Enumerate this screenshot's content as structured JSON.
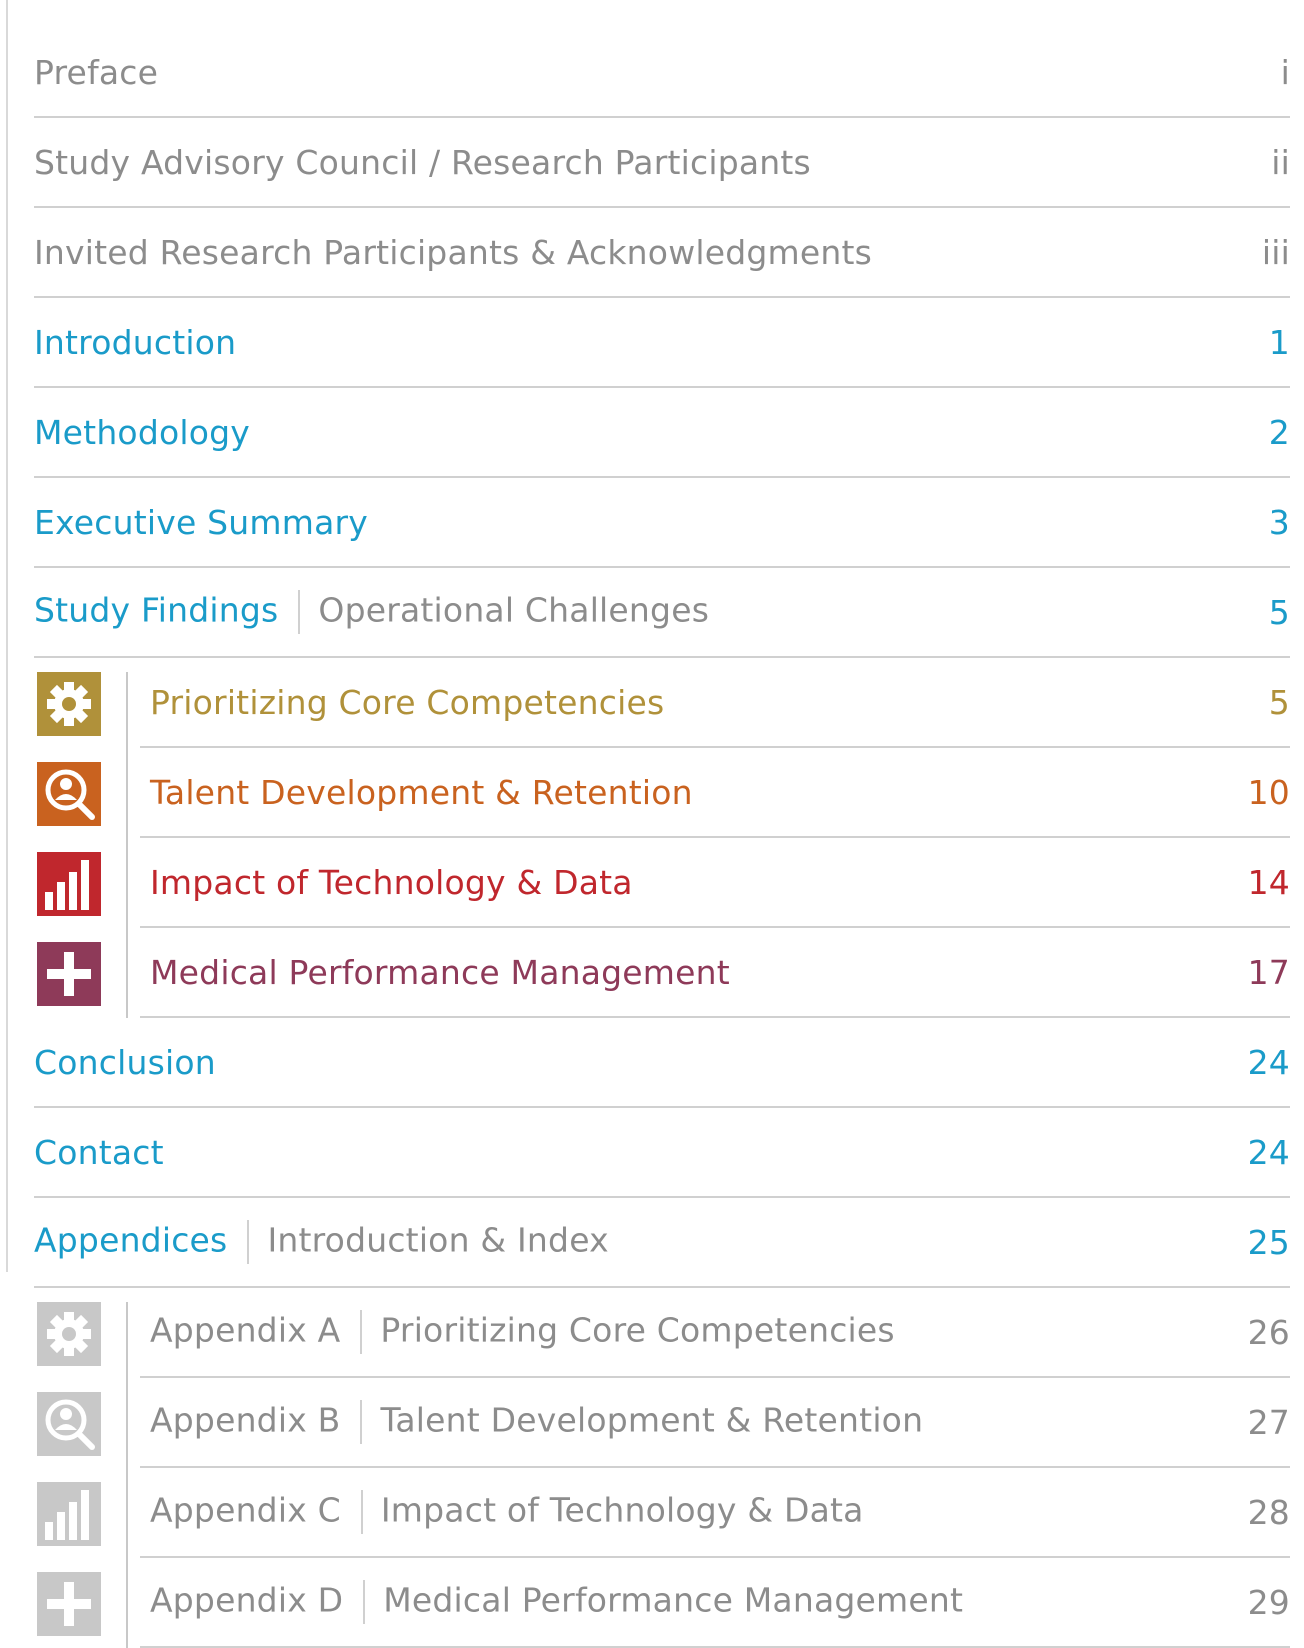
{
  "colors": {
    "blue": "#1a9bc9",
    "gray": "#8c8c8c",
    "gold": "#b0913a",
    "orange": "#c9621f",
    "red": "#c0272d",
    "plum": "#8e3a59",
    "icon_gray": "#c8c8c8"
  },
  "toc": {
    "preface": {
      "label": "Preface",
      "page": "i"
    },
    "advisory": {
      "label": "Study Advisory Council / Research Participants",
      "page": "ii"
    },
    "invited": {
      "label": "Invited Research Participants & Acknowledgments",
      "page": "iii"
    },
    "introduction": {
      "label": "Introduction",
      "page": "1"
    },
    "methodology": {
      "label": "Methodology",
      "page": "2"
    },
    "executive": {
      "label": "Executive Summary",
      "page": "3"
    },
    "findings": {
      "label": "Study Findings",
      "sublabel": "Operational Challenges",
      "page": "5"
    },
    "findings_items": [
      {
        "label": "Prioritizing Core Competencies",
        "page": "5",
        "icon": "gear-icon"
      },
      {
        "label": "Talent Development & Retention",
        "page": "10",
        "icon": "person-search-icon"
      },
      {
        "label": "Impact of Technology & Data",
        "page": "14",
        "icon": "bar-chart-icon"
      },
      {
        "label": "Medical Performance Management",
        "page": "17",
        "icon": "medical-cross-icon"
      }
    ],
    "conclusion": {
      "label": "Conclusion",
      "page": "24"
    },
    "contact": {
      "label": "Contact",
      "page": "24"
    },
    "appendices": {
      "label": "Appendices",
      "sublabel": "Introduction & Index",
      "page": "25"
    },
    "appendix_items": [
      {
        "label": "Appendix A",
        "sublabel": "Prioritizing Core Competencies",
        "page": "26",
        "icon": "gear-icon"
      },
      {
        "label": "Appendix B",
        "sublabel": "Talent Development & Retention",
        "page": "27",
        "icon": "person-search-icon"
      },
      {
        "label": "Appendix C",
        "sublabel": "Impact of Technology & Data",
        "page": "28",
        "icon": "bar-chart-icon"
      },
      {
        "label": "Appendix D",
        "sublabel": "Medical Performance Management",
        "page": "29",
        "icon": "medical-cross-icon"
      }
    ]
  }
}
